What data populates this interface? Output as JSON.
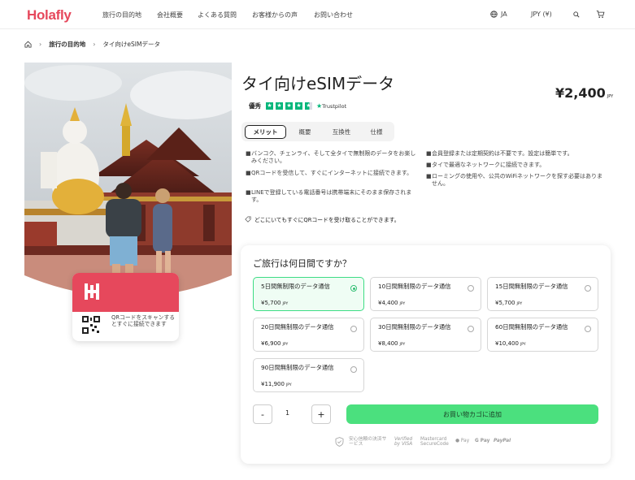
{
  "header": {
    "logo": "Holafly",
    "nav": [
      "旅行の目的地",
      "会社概要",
      "よくある質問",
      "お客様からの声",
      "お問い合わせ"
    ],
    "language": "JA",
    "currency": "JPY (¥)"
  },
  "breadcrumb": {
    "destinations": "旅行の目的地",
    "current": "タイ向けeSIMデータ"
  },
  "product": {
    "title": "タイ向けeSIMデータ",
    "price": "¥2,400",
    "price_currency": "JPY",
    "rating_label": "優秀",
    "trustpilot": "Trustpilot",
    "hero_card_text": "QRコードをスキャンするとすぐに接続できます"
  },
  "tabs": [
    "メリット",
    "概要",
    "互換性",
    "仕様"
  ],
  "benefits_left": [
    "バンコク、チェンライ、そして全タイで無制限のデータをお楽しみください。",
    "QRコードを受信して、すぐにインターネットに接続できます。",
    "LINEで登録している電話番号は携帯端末にそのまま保存されます。"
  ],
  "benefits_right": [
    "会員登録または定期契約は不要です。設定は簡単です。",
    "タイで最適なネットワークに接続できます。",
    "ローミングの使用や、公共のWiFiネットワークを探す必要はありません。"
  ],
  "qr_note": "どこにいてもすぐにQRコードを受け取ることができます。",
  "plans": {
    "question": "ご旅行は何日間ですか？",
    "items": [
      {
        "label": "5日間無制限のデータ通信",
        "price": "¥5,700",
        "currency": "JPY",
        "selected": true
      },
      {
        "label": "10日間無制限のデータ通信",
        "price": "¥4,400",
        "currency": "JPY",
        "selected": false
      },
      {
        "label": "15日間無制限のデータ通信",
        "price": "¥5,700",
        "currency": "JPY",
        "selected": false
      },
      {
        "label": "20日間無制限のデータ通信",
        "price": "¥6,900",
        "currency": "JPY",
        "selected": false
      },
      {
        "label": "30日間無制限のデータ通信",
        "price": "¥8,400",
        "currency": "JPY",
        "selected": false
      },
      {
        "label": "60日間無制限のデータ通信",
        "price": "¥10,400",
        "currency": "JPY",
        "selected": false
      },
      {
        "label": "90日間無制限のデータ通信",
        "price": "¥11,900",
        "currency": "JPY",
        "selected": false
      }
    ]
  },
  "quantity": {
    "minus": "-",
    "value": "1",
    "plus": "+"
  },
  "cart_button": "お買い物カゴに追加",
  "payments": {
    "secure_label": "安心信頼の決済サービス",
    "visa": "Verified by VISA",
    "mastercard": "Mastercard SecureCode",
    "applepay": "Pay",
    "gpay": "G Pay",
    "paypal": "PayPal"
  },
  "colors": {
    "brand": "#e6485c",
    "cta": "#4be07e",
    "selected_border": "#3ddc84",
    "trustpilot": "#00b67a"
  }
}
